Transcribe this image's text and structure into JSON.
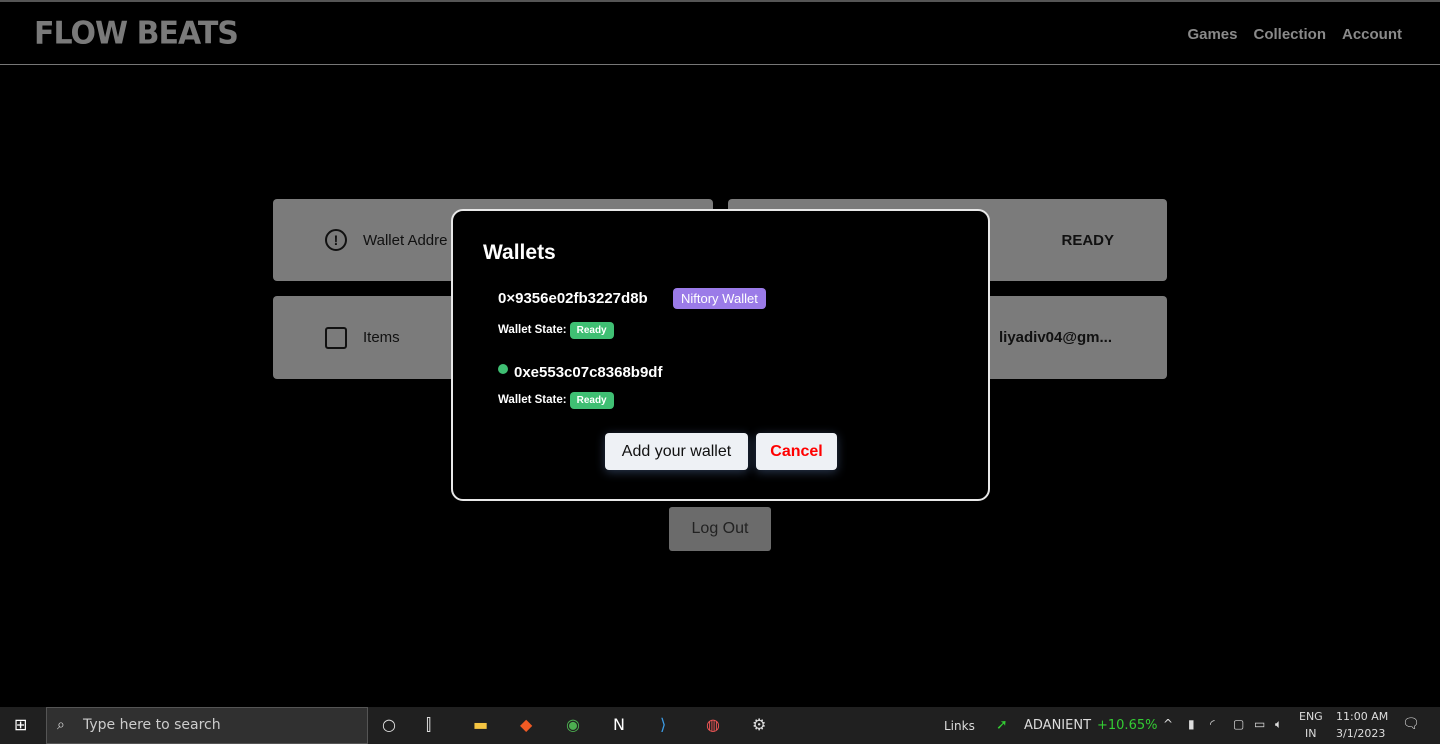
{
  "header": {
    "logo": "FLOW BEATS",
    "nav": [
      "Games",
      "Collection",
      "Account"
    ]
  },
  "cards": {
    "wallet_address": "Wallet Addre",
    "status": "READY",
    "items": "Items",
    "email": "liyadiv04@gm..."
  },
  "logout": "Log Out",
  "modal": {
    "title": "Wallets",
    "wallets": [
      {
        "address": "0×9356e02fb3227d8b",
        "tag": "Niftory Wallet",
        "state_label": "Wallet State:",
        "state": "Ready"
      },
      {
        "address": "0xe553c07c8368b9df",
        "state_label": "Wallet State:",
        "state": "Ready"
      }
    ],
    "add_button": "Add your wallet",
    "cancel_button": "Cancel"
  },
  "taskbar": {
    "search_placeholder": "Type here to search",
    "links": "Links",
    "stock": "ADANIENT",
    "stock_change": "+10.65%",
    "lang": "ENG",
    "region": "IN",
    "time": "11:00 AM",
    "date": "3/1/2023"
  },
  "colors": {
    "badge_purple": "#9b7be8",
    "ready_green": "#3fbf73",
    "cancel_red": "#ff0000"
  }
}
